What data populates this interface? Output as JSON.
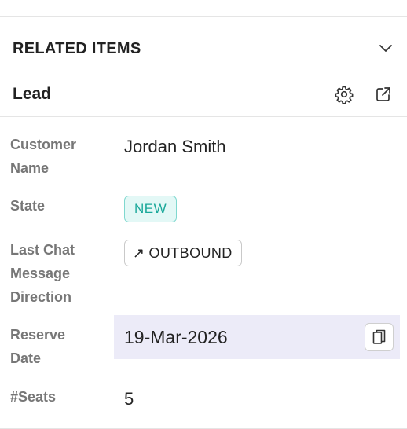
{
  "section": {
    "title": "RELATED ITEMS",
    "toggle_icon": "chevron-down-icon"
  },
  "record": {
    "title": "Lead",
    "actions": [
      {
        "icon": "gear-icon"
      },
      {
        "icon": "external-link-icon"
      }
    ]
  },
  "fields": {
    "customer_name": {
      "label_line1": "Customer",
      "label_line2": "Name",
      "value": "Jordan Smith"
    },
    "state": {
      "label": "State",
      "value": "NEW",
      "badge_color": "#1aa89a",
      "badge_bg": "#e3f8f6"
    },
    "direction": {
      "label_line1": "Last Chat",
      "label_line2": "Message",
      "label_line3": "Direction",
      "value": "OUTBOUND",
      "arrow": "↗"
    },
    "reserve_date": {
      "label_line1": "Reserve",
      "label_line2": "Date",
      "value": "19-Mar-2026",
      "copy_icon": "copy-icon",
      "highlight_bg": "#ecebf8"
    },
    "seats": {
      "label": "#Seats",
      "value": "5"
    }
  }
}
